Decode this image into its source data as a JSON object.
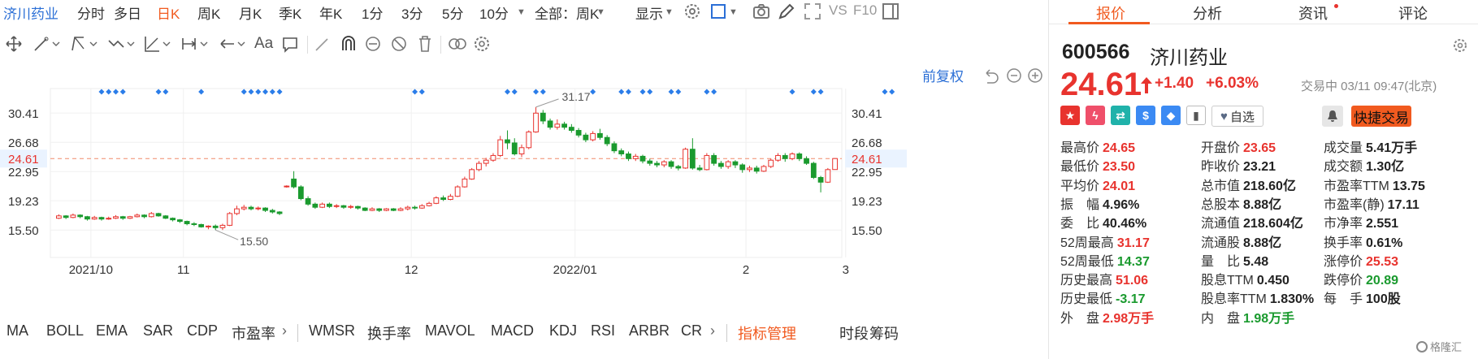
{
  "toolbar": {
    "stock_name": "济川药业",
    "periods": [
      "分时",
      "多日",
      "日K",
      "周K",
      "月K",
      "季K",
      "年K",
      "1分",
      "3分",
      "5分",
      "10分"
    ],
    "active_period": "日K",
    "scope": "全部：周K",
    "display": "显示",
    "vs": "VS",
    "f10": "F10"
  },
  "drawing_tools": {
    "text_tool": "Aa"
  },
  "adjust_label": "前复权",
  "chart_data": {
    "type": "candlestick",
    "yticks": [
      "30.41",
      "26.68",
      "22.95",
      "19.23",
      "15.50"
    ],
    "ylim": [
      12.0,
      32.5
    ],
    "xticks": [
      "2021/10",
      "11",
      "12",
      "2022/01",
      "2",
      "3"
    ],
    "current_price_label": "24.61",
    "high_annotation": "31.17",
    "low_annotation": "15.50",
    "candles": [
      {
        "o": 17.0,
        "c": 17.3,
        "h": 17.5,
        "l": 16.9
      },
      {
        "o": 17.3,
        "c": 17.1,
        "h": 17.4,
        "l": 16.9
      },
      {
        "o": 17.1,
        "c": 17.4,
        "h": 17.6,
        "l": 17.0
      },
      {
        "o": 17.4,
        "c": 17.2,
        "h": 17.5,
        "l": 17.0
      },
      {
        "o": 17.2,
        "c": 16.9,
        "h": 17.3,
        "l": 16.7
      },
      {
        "o": 16.9,
        "c": 17.1,
        "h": 17.3,
        "l": 16.8
      },
      {
        "o": 17.1,
        "c": 16.9,
        "h": 17.2,
        "l": 16.7
      },
      {
        "o": 16.9,
        "c": 17.0,
        "h": 17.2,
        "l": 16.8
      },
      {
        "o": 17.0,
        "c": 17.2,
        "h": 17.4,
        "l": 16.9
      },
      {
        "o": 17.2,
        "c": 17.0,
        "h": 17.3,
        "l": 16.8
      },
      {
        "o": 17.0,
        "c": 17.2,
        "h": 17.3,
        "l": 16.9
      },
      {
        "o": 17.2,
        "c": 17.4,
        "h": 17.6,
        "l": 17.1
      },
      {
        "o": 17.4,
        "c": 17.2,
        "h": 17.5,
        "l": 17.0
      },
      {
        "o": 17.2,
        "c": 17.6,
        "h": 17.8,
        "l": 17.1
      },
      {
        "o": 17.6,
        "c": 17.3,
        "h": 17.7,
        "l": 17.2
      },
      {
        "o": 17.3,
        "c": 17.0,
        "h": 17.4,
        "l": 16.9
      },
      {
        "o": 17.0,
        "c": 16.8,
        "h": 17.1,
        "l": 16.6
      },
      {
        "o": 16.8,
        "c": 16.6,
        "h": 16.9,
        "l": 16.4
      },
      {
        "o": 16.6,
        "c": 16.3,
        "h": 16.7,
        "l": 16.1
      },
      {
        "o": 16.3,
        "c": 16.2,
        "h": 16.5,
        "l": 16.0
      },
      {
        "o": 16.2,
        "c": 15.9,
        "h": 16.3,
        "l": 15.8
      },
      {
        "o": 15.9,
        "c": 16.0,
        "h": 16.1,
        "l": 15.6
      },
      {
        "o": 16.0,
        "c": 15.8,
        "h": 16.2,
        "l": 15.5
      },
      {
        "o": 15.8,
        "c": 16.1,
        "h": 16.3,
        "l": 15.5
      },
      {
        "o": 16.1,
        "c": 17.6,
        "h": 17.8,
        "l": 16.0
      },
      {
        "o": 17.6,
        "c": 18.2,
        "h": 18.6,
        "l": 17.4
      },
      {
        "o": 18.2,
        "c": 18.4,
        "h": 18.7,
        "l": 18.0
      },
      {
        "o": 18.4,
        "c": 18.2,
        "h": 18.6,
        "l": 18.0
      },
      {
        "o": 18.2,
        "c": 18.3,
        "h": 18.5,
        "l": 18.0
      },
      {
        "o": 18.3,
        "c": 18.0,
        "h": 18.4,
        "l": 17.8
      },
      {
        "o": 18.0,
        "c": 17.8,
        "h": 18.2,
        "l": 17.6
      },
      {
        "o": 17.8,
        "c": 17.6,
        "h": 17.9,
        "l": 17.4
      },
      {
        "o": 21.0,
        "c": 21.1,
        "h": 21.2,
        "l": 20.9
      },
      {
        "o": 22.0,
        "c": 21.0,
        "h": 23.0,
        "l": 20.8
      },
      {
        "o": 21.0,
        "c": 19.5,
        "h": 21.2,
        "l": 19.3
      },
      {
        "o": 19.5,
        "c": 18.8,
        "h": 19.8,
        "l": 18.6
      },
      {
        "o": 18.8,
        "c": 18.4,
        "h": 19.0,
        "l": 18.2
      },
      {
        "o": 18.4,
        "c": 18.8,
        "h": 19.0,
        "l": 18.3
      },
      {
        "o": 18.8,
        "c": 18.5,
        "h": 19.0,
        "l": 18.3
      },
      {
        "o": 18.5,
        "c": 18.6,
        "h": 18.8,
        "l": 18.3
      },
      {
        "o": 18.6,
        "c": 18.4,
        "h": 18.7,
        "l": 18.2
      },
      {
        "o": 18.4,
        "c": 18.5,
        "h": 18.7,
        "l": 18.2
      },
      {
        "o": 18.5,
        "c": 18.3,
        "h": 18.6,
        "l": 18.1
      },
      {
        "o": 18.3,
        "c": 18.0,
        "h": 18.4,
        "l": 17.9
      },
      {
        "o": 18.0,
        "c": 18.2,
        "h": 18.4,
        "l": 17.9
      },
      {
        "o": 18.2,
        "c": 18.0,
        "h": 18.3,
        "l": 17.8
      },
      {
        "o": 18.0,
        "c": 18.2,
        "h": 18.3,
        "l": 17.9
      },
      {
        "o": 18.2,
        "c": 18.0,
        "h": 18.3,
        "l": 17.9
      },
      {
        "o": 18.0,
        "c": 18.2,
        "h": 18.4,
        "l": 17.9
      },
      {
        "o": 18.2,
        "c": 18.4,
        "h": 18.6,
        "l": 18.0
      },
      {
        "o": 18.4,
        "c": 18.3,
        "h": 18.6,
        "l": 18.1
      },
      {
        "o": 18.3,
        "c": 18.6,
        "h": 18.8,
        "l": 18.2
      },
      {
        "o": 18.6,
        "c": 18.9,
        "h": 19.1,
        "l": 18.5
      },
      {
        "o": 18.9,
        "c": 19.6,
        "h": 19.8,
        "l": 18.8
      },
      {
        "o": 19.6,
        "c": 19.4,
        "h": 19.9,
        "l": 19.2
      },
      {
        "o": 19.4,
        "c": 19.8,
        "h": 20.1,
        "l": 19.3
      },
      {
        "o": 19.8,
        "c": 21.0,
        "h": 21.2,
        "l": 19.7
      },
      {
        "o": 21.0,
        "c": 22.0,
        "h": 22.3,
        "l": 20.9
      },
      {
        "o": 22.0,
        "c": 23.2,
        "h": 23.4,
        "l": 21.9
      },
      {
        "o": 23.2,
        "c": 24.0,
        "h": 24.3,
        "l": 23.0
      },
      {
        "o": 24.0,
        "c": 24.4,
        "h": 24.7,
        "l": 23.6
      },
      {
        "o": 24.4,
        "c": 25.0,
        "h": 25.3,
        "l": 24.2
      },
      {
        "o": 25.0,
        "c": 27.0,
        "h": 27.5,
        "l": 24.8
      },
      {
        "o": 27.0,
        "c": 26.6,
        "h": 28.2,
        "l": 25.8
      },
      {
        "o": 26.6,
        "c": 25.2,
        "h": 27.2,
        "l": 25.0
      },
      {
        "o": 25.2,
        "c": 26.0,
        "h": 26.4,
        "l": 24.8
      },
      {
        "o": 26.0,
        "c": 28.0,
        "h": 28.2,
        "l": 25.8
      },
      {
        "o": 28.0,
        "c": 30.4,
        "h": 31.17,
        "l": 27.9
      },
      {
        "o": 30.4,
        "c": 29.4,
        "h": 30.8,
        "l": 29.0
      },
      {
        "o": 29.4,
        "c": 28.6,
        "h": 29.7,
        "l": 28.3
      },
      {
        "o": 28.6,
        "c": 29.0,
        "h": 29.6,
        "l": 28.3
      },
      {
        "o": 29.0,
        "c": 28.6,
        "h": 29.3,
        "l": 28.3
      },
      {
        "o": 28.6,
        "c": 28.2,
        "h": 29.0,
        "l": 27.9
      },
      {
        "o": 28.2,
        "c": 27.6,
        "h": 28.5,
        "l": 27.3
      },
      {
        "o": 27.6,
        "c": 27.0,
        "h": 27.9,
        "l": 26.7
      },
      {
        "o": 27.0,
        "c": 27.8,
        "h": 28.1,
        "l": 26.8
      },
      {
        "o": 27.8,
        "c": 27.3,
        "h": 28.4,
        "l": 27.0
      },
      {
        "o": 27.3,
        "c": 26.5,
        "h": 27.6,
        "l": 26.2
      },
      {
        "o": 26.5,
        "c": 25.6,
        "h": 26.8,
        "l": 25.3
      },
      {
        "o": 25.6,
        "c": 25.2,
        "h": 25.9,
        "l": 24.9
      },
      {
        "o": 25.2,
        "c": 24.6,
        "h": 25.5,
        "l": 24.3
      },
      {
        "o": 24.6,
        "c": 24.9,
        "h": 25.2,
        "l": 24.3
      },
      {
        "o": 24.9,
        "c": 24.3,
        "h": 25.1,
        "l": 24.0
      },
      {
        "o": 24.3,
        "c": 24.0,
        "h": 24.6,
        "l": 23.7
      },
      {
        "o": 24.0,
        "c": 23.8,
        "h": 24.3,
        "l": 23.5
      },
      {
        "o": 23.8,
        "c": 24.2,
        "h": 24.4,
        "l": 23.5
      },
      {
        "o": 24.2,
        "c": 23.6,
        "h": 24.4,
        "l": 23.3
      },
      {
        "o": 23.6,
        "c": 23.4,
        "h": 23.8,
        "l": 23.1
      },
      {
        "o": 23.4,
        "c": 25.8,
        "h": 26.0,
        "l": 23.3
      },
      {
        "o": 25.8,
        "c": 23.4,
        "h": 27.2,
        "l": 23.2
      },
      {
        "o": 23.4,
        "c": 23.2,
        "h": 23.8,
        "l": 23.0
      },
      {
        "o": 23.2,
        "c": 25.0,
        "h": 25.3,
        "l": 23.1
      },
      {
        "o": 25.0,
        "c": 24.0,
        "h": 25.3,
        "l": 23.7
      },
      {
        "o": 24.0,
        "c": 23.6,
        "h": 24.3,
        "l": 23.3
      },
      {
        "o": 23.6,
        "c": 24.2,
        "h": 24.4,
        "l": 23.3
      },
      {
        "o": 24.2,
        "c": 23.8,
        "h": 24.4,
        "l": 23.4
      },
      {
        "o": 23.8,
        "c": 23.2,
        "h": 24.0,
        "l": 22.8
      },
      {
        "o": 23.2,
        "c": 23.4,
        "h": 23.7,
        "l": 22.9
      },
      {
        "o": 23.4,
        "c": 23.0,
        "h": 23.7,
        "l": 22.7
      },
      {
        "o": 23.0,
        "c": 23.6,
        "h": 23.8,
        "l": 22.9
      },
      {
        "o": 23.6,
        "c": 24.4,
        "h": 24.6,
        "l": 23.4
      },
      {
        "o": 24.4,
        "c": 25.0,
        "h": 25.3,
        "l": 24.2
      },
      {
        "o": 25.0,
        "c": 24.6,
        "h": 25.3,
        "l": 24.2
      },
      {
        "o": 24.6,
        "c": 25.2,
        "h": 25.4,
        "l": 24.4
      },
      {
        "o": 25.2,
        "c": 24.6,
        "h": 25.4,
        "l": 24.3
      },
      {
        "o": 24.6,
        "c": 24.0,
        "h": 24.9,
        "l": 23.8
      },
      {
        "o": 24.0,
        "c": 22.2,
        "h": 24.2,
        "l": 22.0
      },
      {
        "o": 22.2,
        "c": 21.6,
        "h": 22.4,
        "l": 20.3
      },
      {
        "o": 21.6,
        "c": 23.2,
        "h": 23.4,
        "l": 21.5
      },
      {
        "o": 23.21,
        "c": 24.61,
        "h": 24.65,
        "l": 23.5
      }
    ],
    "event_markers": [
      6,
      7,
      8,
      9,
      14,
      15,
      20,
      26,
      27,
      28,
      29,
      30,
      31,
      50,
      51,
      63,
      64,
      67,
      68,
      75,
      79,
      80,
      82,
      83,
      86,
      87,
      91,
      92,
      103,
      106,
      107,
      116,
      117
    ]
  },
  "indicators": [
    "MA",
    "BOLL",
    "EMA",
    "SAR",
    "CDP",
    "市盈率",
    "WMSR",
    "换手率",
    "MAVOL",
    "MACD",
    "KDJ",
    "RSI",
    "ARBR",
    "CR"
  ],
  "indicator_manage": "指标管理",
  "indicator_extra": [
    "时段",
    "筹码"
  ],
  "quote": {
    "tabs": [
      "报价",
      "分析",
      "资讯",
      "评论"
    ],
    "code": "600566",
    "name": "济川药业",
    "price": "24.61",
    "change": "+1.40",
    "change_pct": "+6.03%",
    "status": "交易中 03/11 09:47(北京)",
    "watch_label": "自选",
    "trade_label": "快捷交易",
    "stats": [
      {
        "label": "最高价",
        "value": "24.65",
        "color": "red"
      },
      {
        "label": "开盘价",
        "value": "23.65",
        "color": "red"
      },
      {
        "label": "成交量",
        "value": "5.41万手",
        "color": "dark"
      },
      {
        "label": "最低价",
        "value": "23.50",
        "color": "red"
      },
      {
        "label": "昨收价",
        "value": "23.21",
        "color": "dark"
      },
      {
        "label": "成交额",
        "value": "1.30亿",
        "color": "dark"
      },
      {
        "label": "平均价",
        "value": "24.01",
        "color": "red"
      },
      {
        "label": "总市值",
        "value": "218.60亿",
        "color": "dark"
      },
      {
        "label": "市盈率TTM",
        "value": "13.75",
        "color": "dark"
      },
      {
        "label": "振　幅",
        "value": "4.96%",
        "color": "dark"
      },
      {
        "label": "总股本",
        "value": "8.88亿",
        "color": "dark"
      },
      {
        "label": "市盈率(静)",
        "value": "17.11",
        "color": "dark"
      },
      {
        "label": "委　比",
        "value": "40.46%",
        "color": "dark"
      },
      {
        "label": "流通值",
        "value": "218.604亿",
        "color": "dark"
      },
      {
        "label": "市净率",
        "value": "2.551",
        "color": "dark"
      },
      {
        "label": "52周最高",
        "value": "31.17",
        "color": "red"
      },
      {
        "label": "流通股",
        "value": "8.88亿",
        "color": "dark"
      },
      {
        "label": "换手率",
        "value": "0.61%",
        "color": "dark"
      },
      {
        "label": "52周最低",
        "value": "14.37",
        "color": "green"
      },
      {
        "label": "量　比",
        "value": "5.48",
        "color": "dark"
      },
      {
        "label": "涨停价",
        "value": "25.53",
        "color": "red"
      },
      {
        "label": "历史最高",
        "value": "51.06",
        "color": "red"
      },
      {
        "label": "股息TTM",
        "value": "0.450",
        "color": "dark"
      },
      {
        "label": "跌停价",
        "value": "20.89",
        "color": "green"
      },
      {
        "label": "历史最低",
        "value": "-3.17",
        "color": "green"
      },
      {
        "label": "股息率TTM",
        "value": "1.830%",
        "color": "dark"
      },
      {
        "label": "每　手",
        "value": "100股",
        "color": "dark"
      },
      {
        "label": "外　盘",
        "value": "2.98万手",
        "color": "red"
      },
      {
        "label": "内　盘",
        "value": "1.98万手",
        "color": "green"
      }
    ]
  },
  "watermark": "格隆汇",
  "colors": {
    "accent": "#f15a1f",
    "up": "#e8332e",
    "down": "#1a9a2e",
    "link": "#2b6fd6"
  }
}
